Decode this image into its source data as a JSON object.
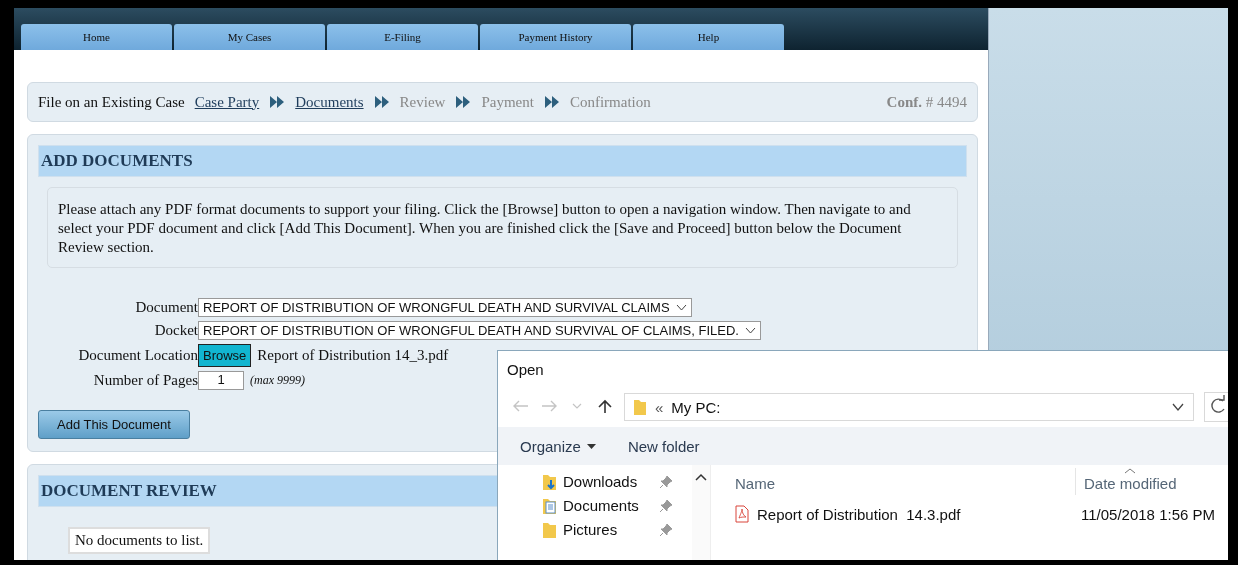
{
  "nav_tabs": [
    {
      "label": "Home"
    },
    {
      "label": "My Cases"
    },
    {
      "label": "E-Filing"
    },
    {
      "label": "Payment History"
    },
    {
      "label": "Help"
    }
  ],
  "breadcrumb": {
    "title": "File on an Existing Case",
    "steps": [
      {
        "label": "Case Party",
        "kind": "link"
      },
      {
        "label": "Documents",
        "kind": "link"
      },
      {
        "label": "Review",
        "kind": "pending"
      },
      {
        "label": "Payment",
        "kind": "pending"
      },
      {
        "label": "Confirmation",
        "kind": "pending"
      }
    ],
    "confirmation_label": "Conf.",
    "confirmation_number": "# 4494"
  },
  "add_documents": {
    "heading": "ADD DOCUMENTS",
    "instructions": "Please attach any PDF format documents to support your filing. Click the [Browse] button to open a navigation window. Then navigate to and select your PDF document and click [Add This Document]. When you are finished click the [Save and Proceed] button below the Document Review section.",
    "fields": [
      {
        "label": "Document",
        "kind": "select",
        "value": "REPORT OF DISTRIBUTION OF WRONGFUL DEATH AND SURVIVAL CLAIMS"
      },
      {
        "label": "Docket",
        "kind": "select",
        "value": "REPORT OF DISTRIBUTION OF WRONGFUL DEATH AND SURVIVAL OF CLAIMS, FILED."
      },
      {
        "label": "Document Location",
        "kind": "file",
        "button": "Browse",
        "value": "Report of Distribution 14_3.pdf"
      },
      {
        "label": "Number of Pages",
        "kind": "number",
        "value": "1",
        "hint": "(max 9999)"
      }
    ],
    "button": "Add This Document"
  },
  "document_review": {
    "heading": "DOCUMENT REVIEW",
    "empty_message": "No documents to list."
  },
  "open_dialog": {
    "title": "Open",
    "nav_buttons": [
      {
        "kind": "back",
        "disabled": true
      },
      {
        "kind": "forward",
        "disabled": true
      },
      {
        "kind": "recent",
        "disabled": true
      },
      {
        "kind": "up",
        "disabled": false
      }
    ],
    "address_prefix": "«",
    "address": "My PC:",
    "toolbar": [
      {
        "label": "Organize",
        "kind": "menu"
      },
      {
        "label": "New folder",
        "kind": "button"
      }
    ],
    "nav_items": [
      {
        "label": "Downloads",
        "kind": "downloads",
        "pinned": true
      },
      {
        "label": "Documents",
        "kind": "documents",
        "pinned": true
      },
      {
        "label": "Pictures",
        "kind": "folder",
        "pinned": true
      }
    ],
    "columns": [
      "Name",
      "Date modified"
    ],
    "files": [
      {
        "name": "Report of Distribution  14.3.pdf",
        "date_modified": "11/05/2018 1:56 PM"
      }
    ]
  }
}
